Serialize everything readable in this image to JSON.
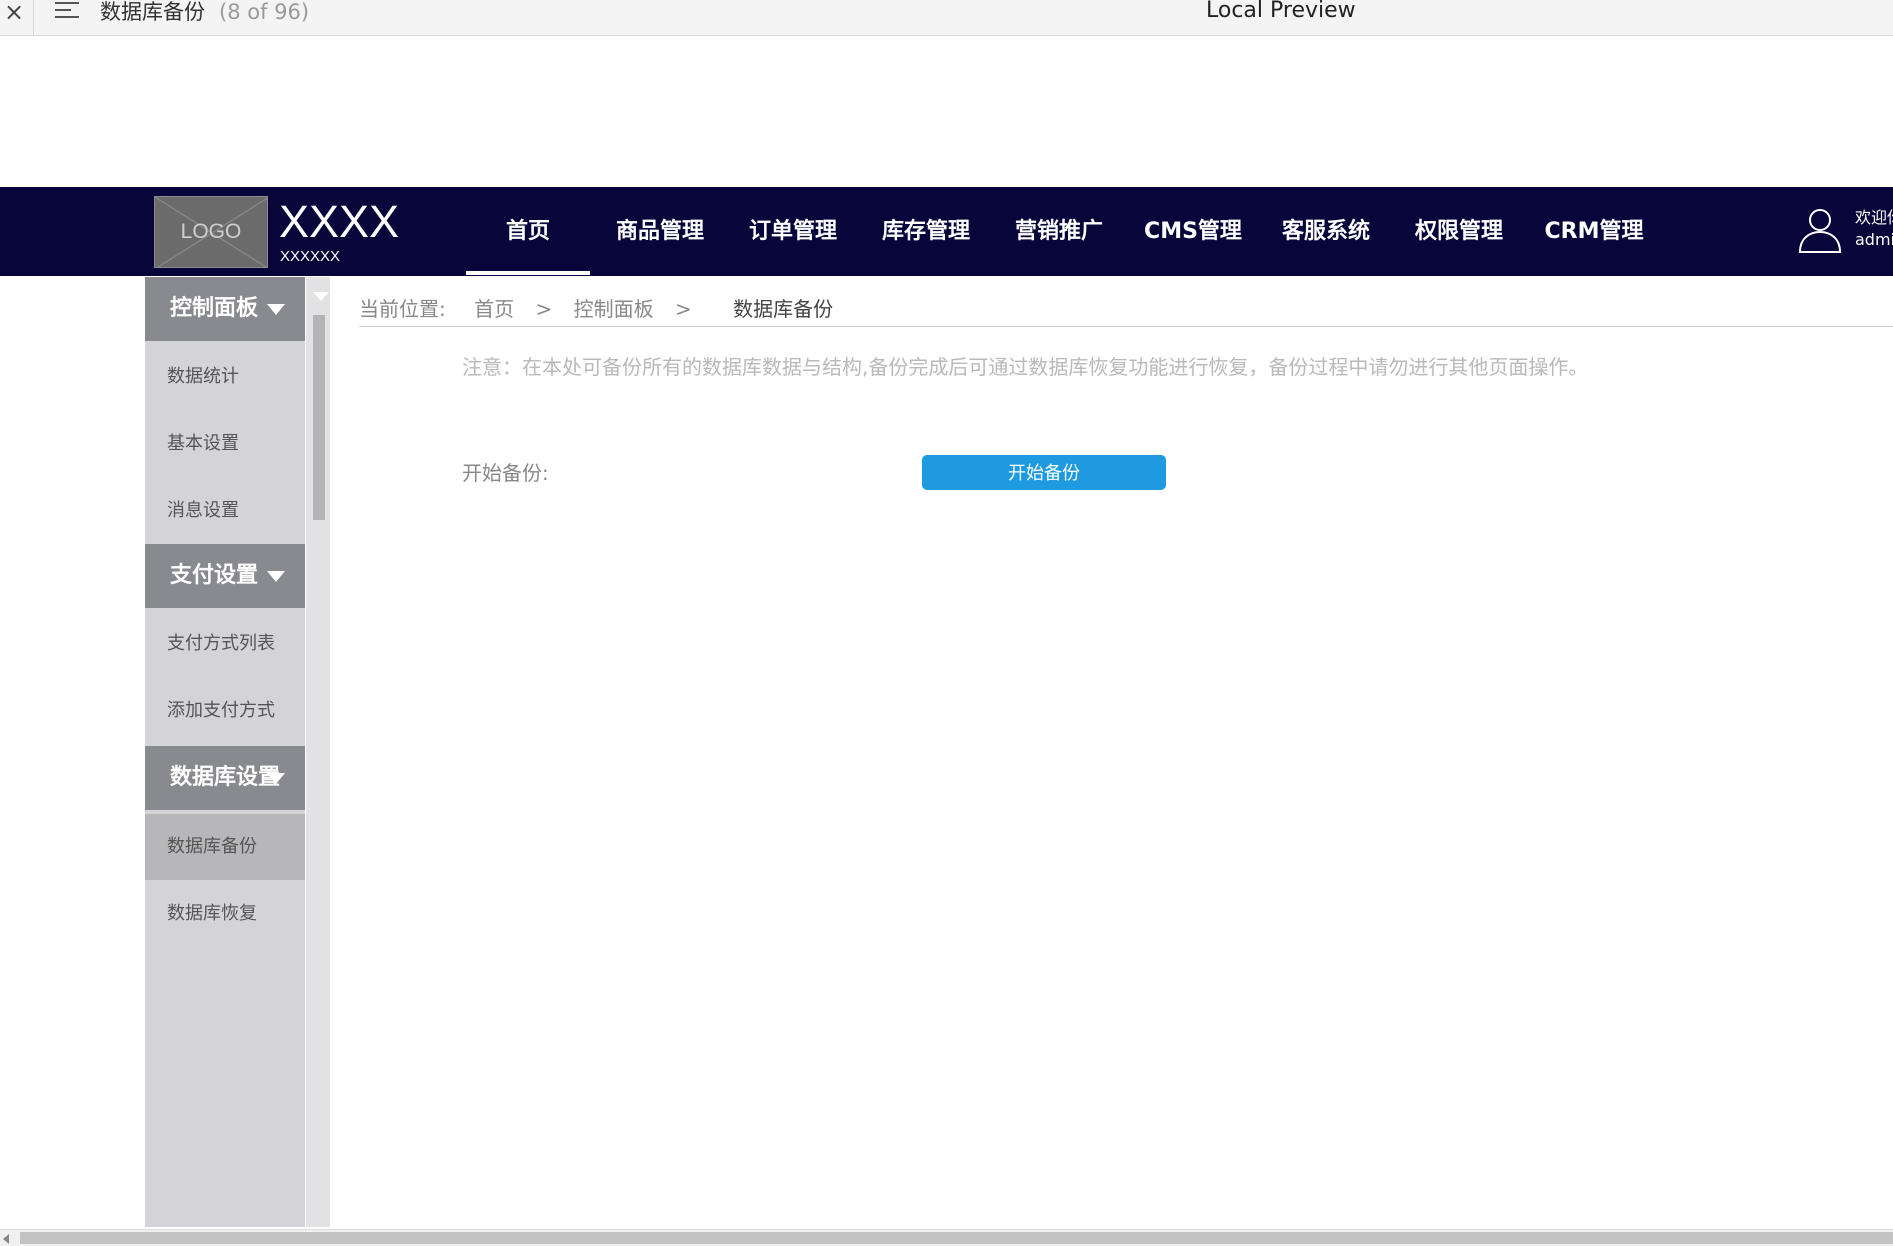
{
  "preview_bar": {
    "close_glyph": "×",
    "page_title": "数据库备份",
    "page_count": "(8 of 96)",
    "center_title": "Local Preview"
  },
  "navbar": {
    "logo_text": "LOGO",
    "brand": "XXXX",
    "brand_sub": "XXXXXX",
    "items": [
      "首页",
      "商品管理",
      "订单管理",
      "库存管理",
      "营销推广",
      "CMS管理",
      "客服系统",
      "权限管理",
      "CRM管理"
    ],
    "active_index": 0,
    "welcome_line1": "欢迎你",
    "welcome_line2": "admin",
    "user_icon": "user-outline-icon",
    "bg_color": "#07053a"
  },
  "sidebar": {
    "groups": [
      {
        "label": "控制面板",
        "items": [
          "数据统计",
          "基本设置",
          "消息设置"
        ]
      },
      {
        "label": "支付设置",
        "items": [
          "支付方式列表",
          "添加支付方式"
        ]
      },
      {
        "label": "数据库设置",
        "items": [
          "数据库备份",
          "数据库恢复"
        ]
      }
    ],
    "active_item": "数据库备份"
  },
  "breadcrumb": {
    "prefix": "当前位置:",
    "crumbs": [
      "首页",
      "控制面板"
    ],
    "separator": ">",
    "current": "数据库备份"
  },
  "content": {
    "notice": "注意：在本处可备份所有的数据库数据与结构,备份完成后可通过数据库恢复功能进行恢复，备份过程中请勿进行其他页面操作。",
    "field_label": "开始备份:",
    "button_label": "开始备份",
    "button_color": "#1e9be0"
  }
}
